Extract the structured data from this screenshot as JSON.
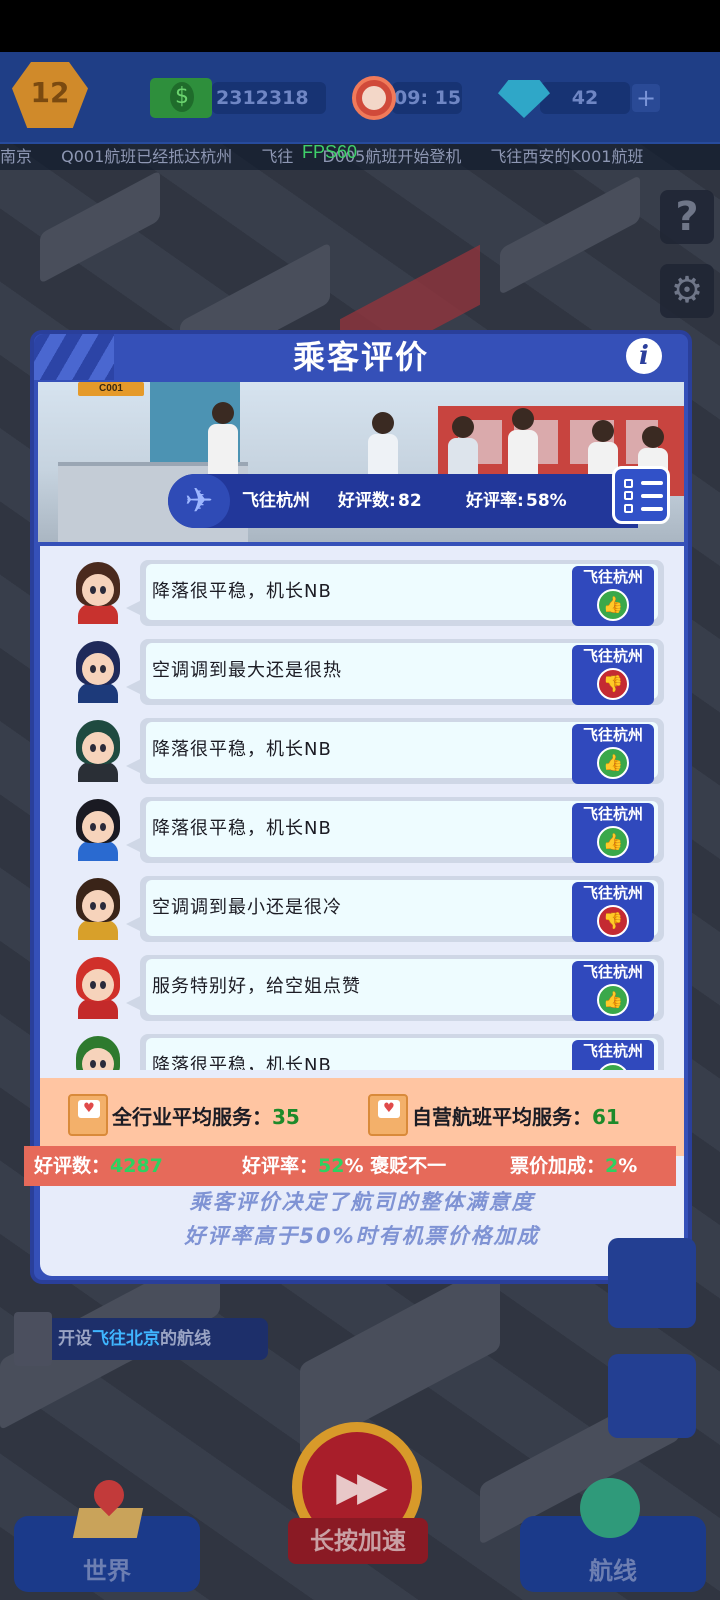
{
  "hud": {
    "level": "12",
    "money": "2312318",
    "time": "09: 15",
    "gems": "42",
    "plus": "+"
  },
  "ticker": [
    "南京",
    "Q001航班已经抵达杭州",
    "飞往",
    "D005航班开始登机",
    "飞往西安的K001航班"
  ],
  "fps": "FPS60",
  "side_buttons": {
    "help": "?",
    "settings": "⚙"
  },
  "dialog": {
    "title": "乘客评价",
    "info": "i",
    "banner_sign": "C001",
    "flight": {
      "destination": "飞往杭州",
      "good_count_label": "好评数:",
      "good_count": "82",
      "good_rate_label": "好评率:",
      "good_rate": "58%"
    },
    "reviews": [
      {
        "text": "降落很平稳，机长NB",
        "tag": "飞往杭州",
        "rating": "up",
        "avatar": {
          "hair": "#4a2a1e",
          "shirt": "#c8322e"
        }
      },
      {
        "text": "空调调到最大还是很热",
        "tag": "飞往杭州",
        "rating": "down",
        "avatar": {
          "hair": "#1f2a5a",
          "shirt": "#1d3a7a"
        }
      },
      {
        "text": "降落很平稳，机长NB",
        "tag": "飞往杭州",
        "rating": "up",
        "avatar": {
          "hair": "#1f4a40",
          "shirt": "#2a2f36"
        }
      },
      {
        "text": "降落很平稳，机长NB",
        "tag": "飞往杭州",
        "rating": "up",
        "avatar": {
          "hair": "#1a1a22",
          "shirt": "#2a6ad0"
        }
      },
      {
        "text": "空调调到最小还是很冷",
        "tag": "飞往杭州",
        "rating": "down",
        "avatar": {
          "hair": "#3a2418",
          "shirt": "#d8a02a"
        }
      },
      {
        "text": "服务特别好，给空姐点赞",
        "tag": "飞往杭州",
        "rating": "up",
        "avatar": {
          "hair": "#d0302a",
          "shirt": "#c42a2a"
        }
      },
      {
        "text": "降落很平稳，机长NB",
        "tag": "飞往杭州",
        "rating": "up",
        "avatar": {
          "hair": "#2e7a2e",
          "shirt": "#2e7a2e"
        }
      }
    ],
    "stats": {
      "industry_label": "全行业平均服务：",
      "industry_value": "35",
      "self_label": "自营航班平均服务：",
      "self_value": "61"
    },
    "summary": {
      "good_count_label": "好评数：",
      "good_count": "4287",
      "good_rate_label": "好评率：",
      "good_rate_value": "52",
      "good_rate_suffix": "% 褒贬不一",
      "price_label": "票价加成：",
      "price_value": "2",
      "price_suffix": "%"
    },
    "footer": [
      "乘客评价决定了航司的整体满意度",
      "好评率高于50%时有机票价格加成"
    ]
  },
  "route_task": {
    "prefix": "开设",
    "highlight": "飞往北京",
    "suffix": "的航线"
  },
  "bottom_nav": {
    "world": "世界",
    "speed": "长按加速",
    "routes": "航线"
  },
  "colors": {
    "dialog": "#3550b8",
    "tag": "#3049bd",
    "thumb_up": "#3aa84a",
    "thumb_down": "#c42a32",
    "stats_bg": "#ffc5a2",
    "summary_bg": "#e66a5a",
    "accent_green": "#2ed160"
  }
}
